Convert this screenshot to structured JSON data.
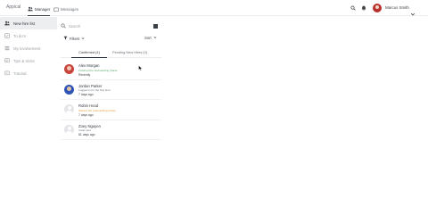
{
  "topbar": {
    "brand": "Appical",
    "tabs": [
      {
        "label": "Manager",
        "icon": "people-icon",
        "active": true
      },
      {
        "label": "Messages",
        "icon": "chat-icon",
        "active": false
      }
    ],
    "user_name": "Marcus Smith"
  },
  "sidebar": {
    "items": [
      {
        "label": "New hire list",
        "icon": "people-icon",
        "active": true
      },
      {
        "label": "To do's",
        "icon": "checklist-icon",
        "active": false
      },
      {
        "label": "My involvement",
        "icon": "list-icon",
        "active": false
      },
      {
        "label": "Tips & tricks",
        "icon": "lightbulb-icon",
        "active": false
      },
      {
        "label": "Tutorial",
        "icon": "video-icon",
        "active": false
      }
    ]
  },
  "search": {
    "placeholder": "Search"
  },
  "filters_label": "Filters",
  "sort_label": "Sort",
  "tabs": {
    "confirmed": "Confirmed (4)",
    "pending": "Pending New Hires (0)"
  },
  "new_hires": [
    {
      "name": "Alex Morgan",
      "status": "Finished the preboarding phase",
      "status_color": "#5aa469",
      "time": "Recently",
      "avatar": "photo1"
    },
    {
      "name": "Jordan Parker",
      "status": "Logged in for the first time",
      "status_color": "#6b7178",
      "time": "7 days ago",
      "avatar": "photo2"
    },
    {
      "name": "Robin Hood",
      "status": "Started the preboarding phase",
      "status_color": "#e39b3a",
      "time": "7 days ago",
      "avatar": "placeholder"
    },
    {
      "name": "Zoey Nguyen",
      "status": "Invite sent",
      "status_color": "#6b7178",
      "time": "81 days ago",
      "avatar": "placeholder"
    }
  ]
}
